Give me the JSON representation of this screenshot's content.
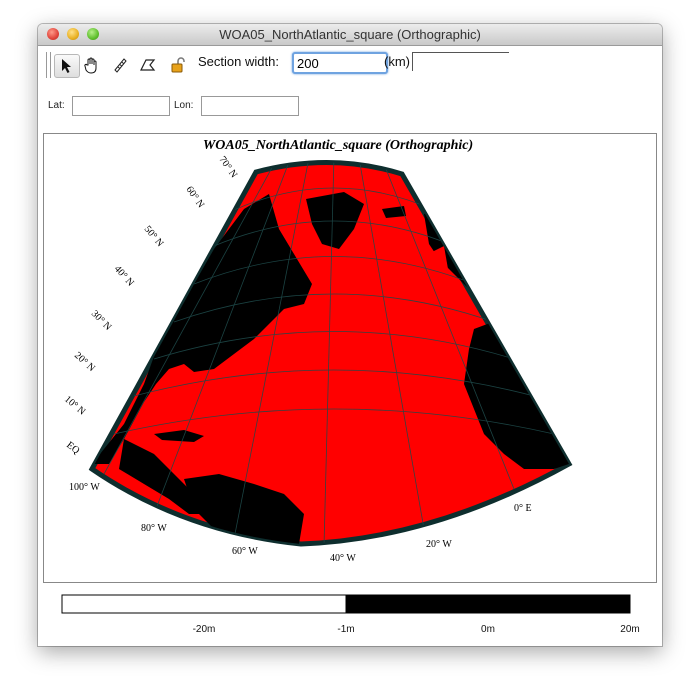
{
  "window": {
    "title": "WOA05_NorthAtlantic_square (Orthographic)"
  },
  "toolbar": {
    "tools": [
      {
        "name": "pointer-tool-icon",
        "glyph": "➤"
      },
      {
        "name": "pan-hand-tool-icon",
        "glyph": "✋"
      },
      {
        "name": "ruler-tool-icon",
        "glyph": "⫽"
      },
      {
        "name": "polygon-tool-icon",
        "glyph": "⏢"
      },
      {
        "name": "lock-tool-icon",
        "glyph": "🔓"
      }
    ],
    "section_width_label": "Section width:",
    "section_width_value": "200",
    "unit_label": "(km)"
  },
  "coords": {
    "lat_label": "Lat:",
    "lon_label": "Lon:",
    "lat_value": "",
    "lon_value": ""
  },
  "map": {
    "title": "WOA05_NorthAtlantic_square (Orthographic)",
    "colors": {
      "ocean": "#ff0000",
      "land": "#000000",
      "graticule": "#1e4a4a",
      "border": "#0e2e2e"
    },
    "lat_labels": [
      "70° N",
      "60° N",
      "50° N",
      "40° N",
      "30° N",
      "20° N",
      "10° N",
      "EQ"
    ],
    "lon_labels": [
      "100° W",
      "80° W",
      "60° W",
      "40° W",
      "20° W",
      "0° E"
    ]
  },
  "legend": {
    "colors": {
      "low": "#ffffff",
      "high": "#000000"
    },
    "ticks": [
      "-20m",
      "-1m",
      "0m",
      "20m"
    ]
  }
}
